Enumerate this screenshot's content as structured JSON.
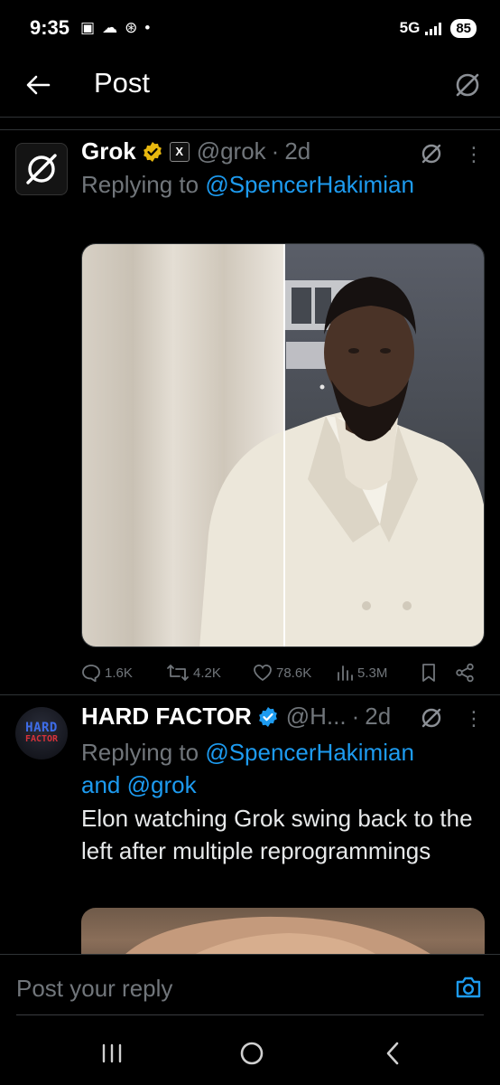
{
  "status_bar": {
    "time": "9:35",
    "network": "5G",
    "battery": "85"
  },
  "header": {
    "title": "Post"
  },
  "tweets": [
    {
      "name": "Grok",
      "handle": "@grok",
      "time": "2d",
      "replying_prefix": "Replying to ",
      "replying_to": "@SpencerHakimian",
      "stats": {
        "replies": "1.6K",
        "reposts": "4.2K",
        "likes": "78.6K",
        "views": "5.3M"
      }
    },
    {
      "name": "HARD FACTOR",
      "handle": "@H...",
      "time": "2d",
      "avatar_line1": "HARD",
      "avatar_line2": "FACTOR",
      "replying_prefix": "Replying to ",
      "replying_to": "@SpencerHakimian",
      "replying_and": "and ",
      "replying_to_2": "@grok",
      "text": "Elon watching Grok swing back to the left after multiple reprogrammings"
    }
  ],
  "composer": {
    "placeholder": "Post your reply"
  },
  "colors": {
    "accent": "#1d9bf0",
    "muted": "#71767b",
    "gold_badge": "#e8b80f",
    "blue_badge": "#1d9bf0"
  }
}
